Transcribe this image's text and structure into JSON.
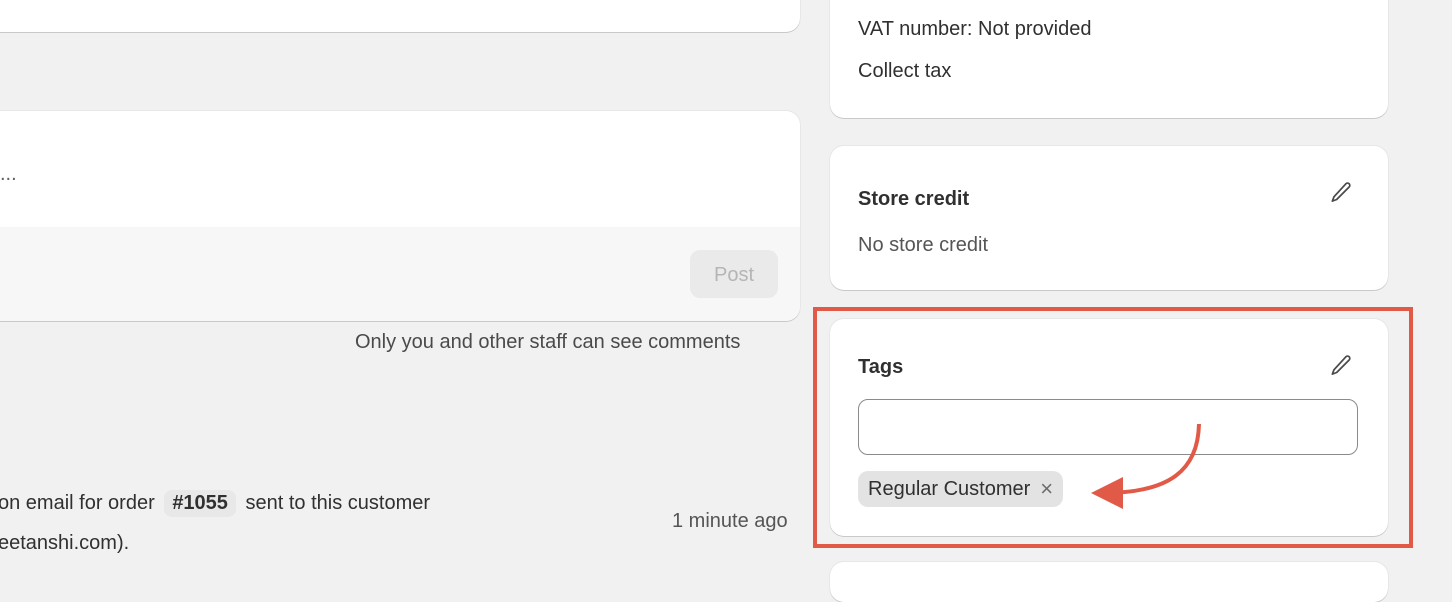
{
  "comment": {
    "placeholder_fragment": "...",
    "post_button": "Post",
    "visibility_note": "Only you and other staff can see comments"
  },
  "timeline": {
    "event_prefix": "on email for order",
    "order_number": "#1055",
    "event_suffix": "sent to this customer",
    "event_line2": "eetanshi.com).",
    "timestamp": "1 minute ago"
  },
  "tax": {
    "vat_line": "VAT number: Not provided",
    "collect_line": "Collect tax"
  },
  "store_credit": {
    "title": "Store credit",
    "value": "No store credit",
    "edit_icon": "pencil-icon"
  },
  "tags": {
    "title": "Tags",
    "edit_icon": "pencil-icon",
    "input_value": "",
    "items": [
      {
        "label": "Regular Customer",
        "remove_icon": "close-icon"
      }
    ]
  },
  "annotation": {
    "highlight_color": "#e05a47"
  }
}
